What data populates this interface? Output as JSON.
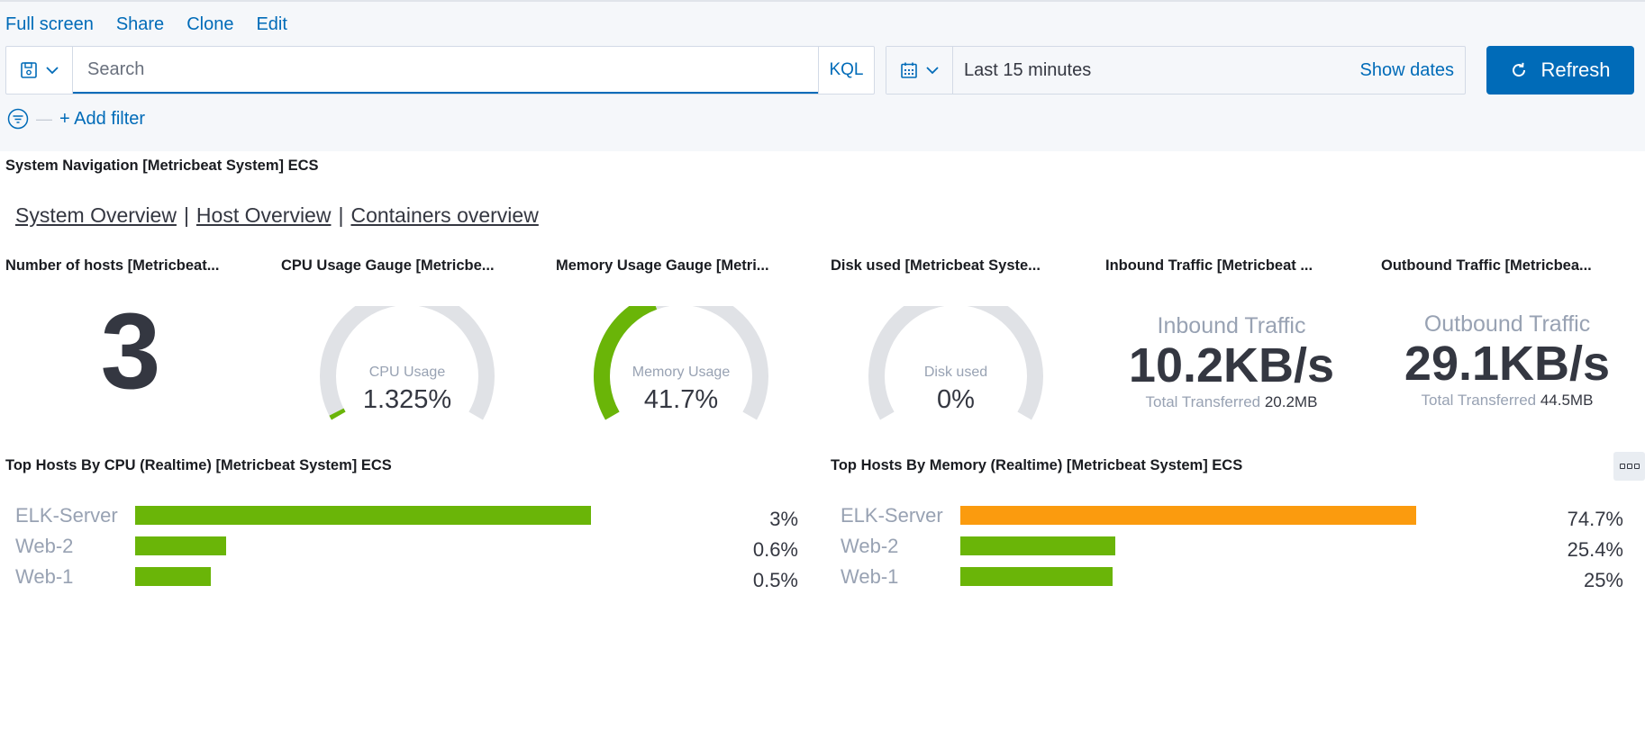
{
  "top_menu": {
    "full_screen": "Full screen",
    "share": "Share",
    "clone": "Clone",
    "edit": "Edit"
  },
  "query": {
    "placeholder": "Search",
    "language": "KQL"
  },
  "time": {
    "range": "Last 15 minutes",
    "show_dates": "Show dates",
    "refresh": "Refresh"
  },
  "filters": {
    "add_filter": "+ Add filter"
  },
  "navigation": {
    "title": "System Navigation [Metricbeat System] ECS",
    "links": [
      "System Overview",
      "Host Overview",
      "Containers overview"
    ],
    "separator": "|"
  },
  "panels": {
    "hosts": {
      "title": "Number of hosts [Metricbeat...",
      "value": "3"
    },
    "cpu": {
      "title": "CPU Usage Gauge [Metricbe...",
      "label": "CPU Usage",
      "value": "1.325%",
      "fraction": 0.01325
    },
    "memory": {
      "title": "Memory Usage Gauge [Metri...",
      "label": "Memory Usage",
      "value": "41.7%",
      "fraction": 0.417
    },
    "disk": {
      "title": "Disk used [Metricbeat Syste...",
      "label": "Disk used",
      "value": "0%",
      "fraction": 0
    },
    "inbound": {
      "title": "Inbound Traffic [Metricbeat ...",
      "label": "Inbound Traffic",
      "value": "10.2KB/s",
      "sub_label": "Total Transferred",
      "sub_value": "20.2MB"
    },
    "outbound": {
      "title": "Outbound Traffic [Metricbea...",
      "label": "Outbound Traffic",
      "value": "29.1KB/s",
      "sub_label": "Total Transferred",
      "sub_value": "44.5MB"
    }
  },
  "top_cpu": {
    "title": "Top Hosts By CPU (Realtime) [Metricbeat System] ECS",
    "max": 3,
    "rows": [
      {
        "host": "ELK-Server",
        "label": "3%",
        "value": 3,
        "color": "#6ab508"
      },
      {
        "host": "Web-2",
        "label": "0.6%",
        "value": 0.6,
        "color": "#6ab508"
      },
      {
        "host": "Web-1",
        "label": "0.5%",
        "value": 0.5,
        "color": "#6ab508"
      }
    ]
  },
  "top_memory": {
    "title": "Top Hosts By Memory (Realtime) [Metricbeat System] ECS",
    "max": 74.7,
    "rows": [
      {
        "host": "ELK-Server",
        "label": "74.7%",
        "value": 74.7,
        "color": "#fb9b0e"
      },
      {
        "host": "Web-2",
        "label": "25.4%",
        "value": 25.4,
        "color": "#6ab508"
      },
      {
        "host": "Web-1",
        "label": "25%",
        "value": 25,
        "color": "#6ab508"
      }
    ]
  },
  "colors": {
    "accent": "#006bb8",
    "gauge_track": "#e0e2e6",
    "gauge_fill": "#6ab508",
    "bar_green": "#6ab508",
    "bar_orange": "#fb9b0e"
  }
}
